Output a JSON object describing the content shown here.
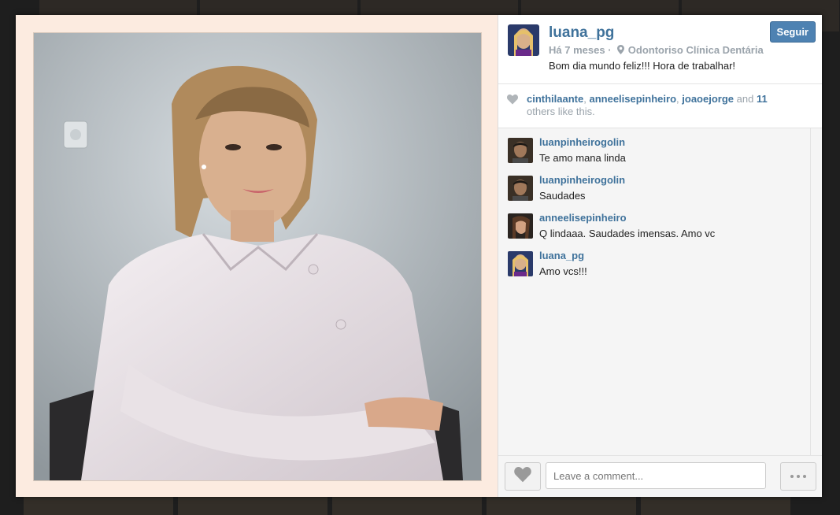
{
  "post": {
    "username": "luana_pg",
    "follow_label": "Seguir",
    "time_ago": "Há 7 meses",
    "separator": "·",
    "location": "Odontoriso Clínica Dentária",
    "caption": "Bom dia mundo feliz!!! Hora de trabalhar!"
  },
  "likes": {
    "users": [
      "cinthilaante",
      "anneelisepinheiro",
      "joaoejorge"
    ],
    "sep1": ", ",
    "sep2": ", ",
    "and_text": " and ",
    "others_count": "11",
    "others_text": " others like this."
  },
  "comments": [
    {
      "user": "luanpinheirogolin",
      "text": "Te amo mana linda"
    },
    {
      "user": "luanpinheirogolin",
      "text": "Saudades"
    },
    {
      "user": "anneelisepinheiro",
      "text": "Q lindaaa. Saudades imensas. Amo vc"
    },
    {
      "user": "luana_pg",
      "text": "Amo vcs!!!"
    }
  ],
  "comment_box": {
    "placeholder": "Leave a comment..."
  },
  "icons": {
    "pin": "location-pin-icon",
    "heart": "heart-icon",
    "more": "ellipsis-icon"
  },
  "colors": {
    "link": "#3f729b",
    "follow_button": "#4e82b2",
    "muted_text": "#9aa3ab",
    "photo_frame": "#fcebe0"
  }
}
